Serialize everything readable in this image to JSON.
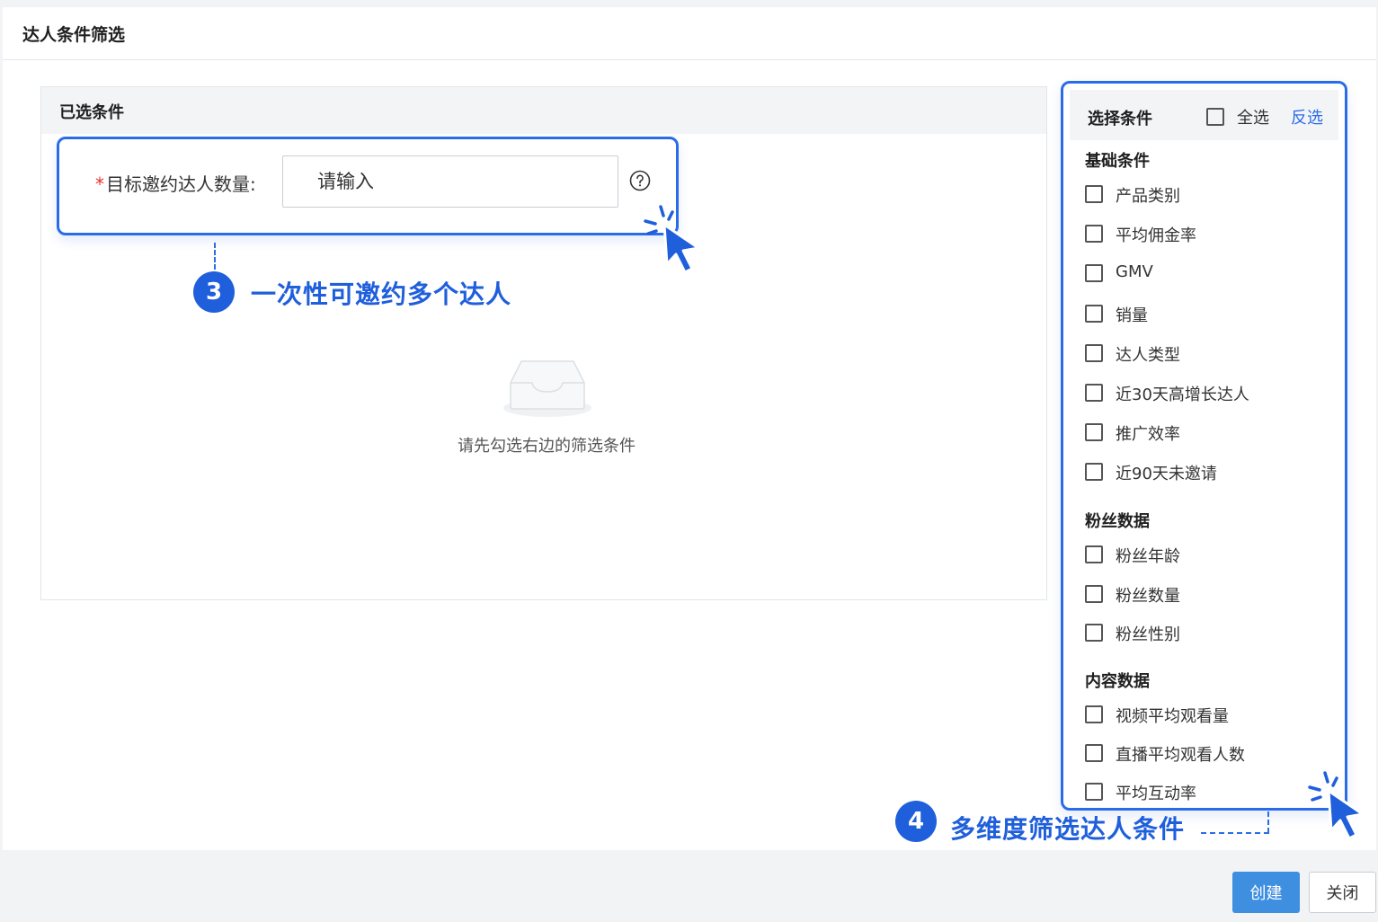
{
  "dialog": {
    "title": "达人条件筛选"
  },
  "selected": {
    "title": "已选条件",
    "field_required_mark": "*",
    "field_label": "目标邀约达人数量:",
    "field_placeholder": "请输入",
    "empty_text": "请先勾选右边的筛选条件"
  },
  "callouts": {
    "step3_number": "3",
    "step3_text": "一次性可邀约多个达人",
    "step4_number": "4",
    "step4_text": "多维度筛选达人条件"
  },
  "conditions": {
    "title": "选择条件",
    "select_all_label": "全选",
    "invert_label": "反选",
    "groups": [
      {
        "title": "基础条件",
        "items": [
          "产品类别",
          "平均佣金率",
          "GMV",
          "销量",
          "达人类型",
          "近30天高增长达人",
          "推广效率",
          "近90天未邀请"
        ]
      },
      {
        "title": "粉丝数据",
        "items": [
          "粉丝年龄",
          "粉丝数量",
          "粉丝性别"
        ]
      },
      {
        "title": "内容数据",
        "items": [
          "视频平均观看量",
          "直播平均观看人数",
          "平均互动率"
        ]
      }
    ]
  },
  "footer": {
    "create_label": "创建",
    "close_label": "关闭"
  },
  "colors": {
    "accent": "#2a6ce8",
    "primary_button": "#3f8fe0",
    "required": "#e5322d"
  }
}
